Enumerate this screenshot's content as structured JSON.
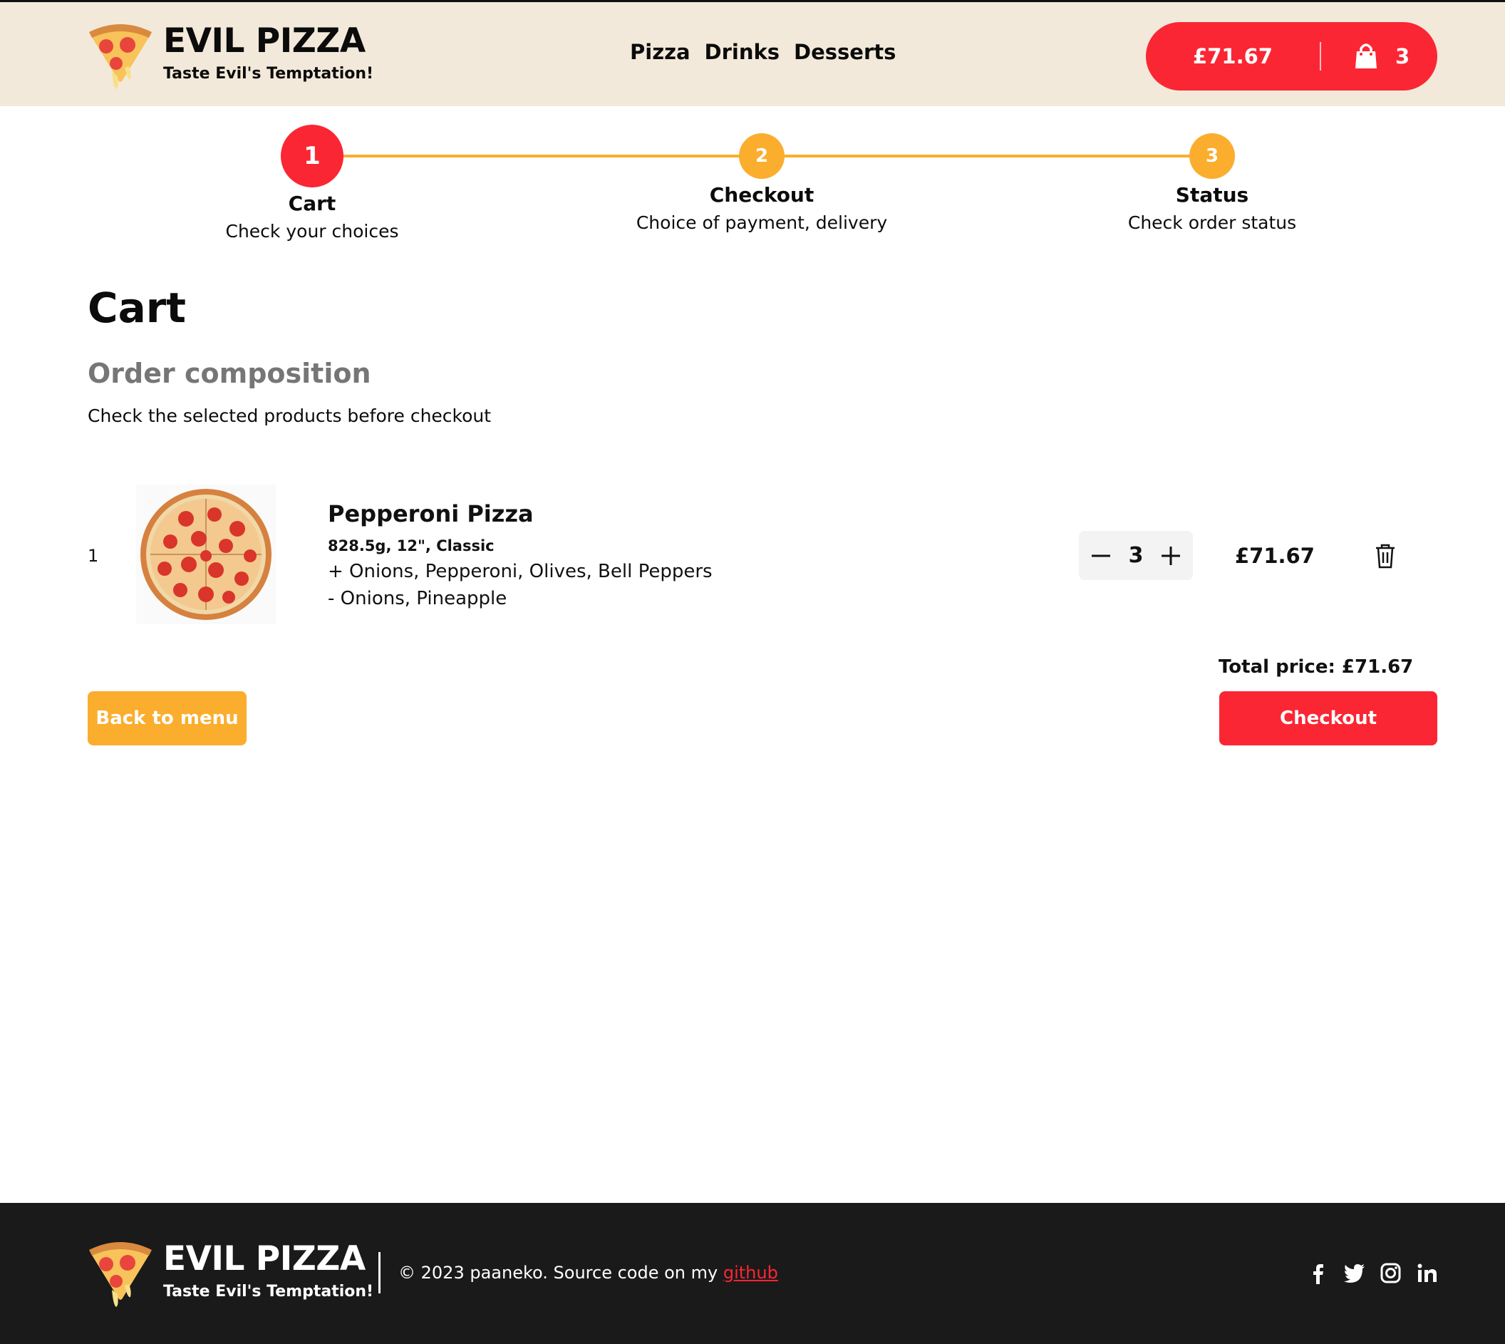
{
  "brand": {
    "name": "EVIL PIZZA",
    "tagline": "Taste Evil's Temptation!"
  },
  "nav": {
    "items": [
      "Pizza",
      "Drinks",
      "Desserts"
    ]
  },
  "cart_button": {
    "price": "£71.67",
    "count": "3"
  },
  "steps": [
    {
      "number": "1",
      "label": "Cart",
      "desc": "Check your choices"
    },
    {
      "number": "2",
      "label": "Checkout",
      "desc": "Choice of payment, delivery"
    },
    {
      "number": "3",
      "label": "Status",
      "desc": "Check order status"
    }
  ],
  "colors": {
    "accent_red": "#fb2633",
    "accent_orange": "#fbad2d",
    "header_bg": "#f3e9da",
    "footer_bg": "#1a1a1a"
  },
  "main": {
    "title": "Cart",
    "subtitle": "Order composition",
    "subdesc": "Check the selected products before checkout",
    "items": [
      {
        "index": "1",
        "name": "Pepperoni Pizza",
        "meta": "828.5g, 12\", Classic",
        "added": "+ Onions, Pepperoni, Olives, Bell Peppers",
        "removed": "- Onions, Pineapple",
        "quantity": "3",
        "price": "£71.67"
      }
    ],
    "total": "Total price: £71.67",
    "back_label": "Back to menu",
    "checkout_label": "Checkout"
  },
  "footer": {
    "copyright": "© 2023 paaneko. Source code on my ",
    "link_label": "github",
    "social_icons": [
      "facebook-icon",
      "twitter-icon",
      "instagram-icon",
      "linkedin-icon"
    ]
  }
}
